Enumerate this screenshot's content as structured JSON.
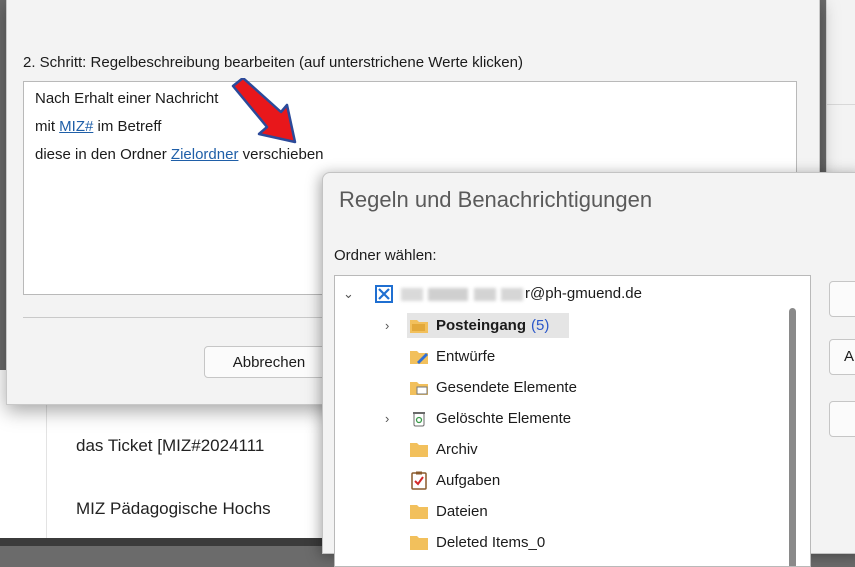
{
  "background": {
    "lines": [
      "das Ticket [MIZ#2024111",
      "MIZ Pädagogische Hochs"
    ]
  },
  "wizard": {
    "step_label": "2. Schritt: Regelbeschreibung bearbeiten (auf unterstrichene Werte klicken)",
    "rule": {
      "line1": "Nach Erhalt einer Nachricht",
      "line2_prefix": "mit ",
      "line2_link": "MIZ#",
      "line2_suffix": " im Betreff",
      "line3_prefix": "diese in den Ordner ",
      "line3_link": "Zielordner",
      "line3_suffix": " verschieben"
    },
    "cancel_label": "Abbrechen"
  },
  "picker": {
    "title": "Regeln und Benachrichtigungen",
    "label": "Ordner wählen:",
    "account": "r@ph-gmuend.de",
    "folders": [
      {
        "label": "Posteingang",
        "count": "(5)",
        "icon": "inbox-icon"
      },
      {
        "label": "Entwürfe",
        "icon": "drafts-icon"
      },
      {
        "label": "Gesendete Elemente",
        "icon": "sent-icon"
      },
      {
        "label": "Gelöschte Elemente",
        "icon": "trash-icon"
      },
      {
        "label": "Archiv",
        "icon": "folder-icon"
      },
      {
        "label": "Aufgaben",
        "icon": "tasks-icon"
      },
      {
        "label": "Dateien",
        "icon": "folder-icon"
      },
      {
        "label": "Deleted Items_0",
        "icon": "folder-icon"
      }
    ],
    "side_button_label": "A"
  },
  "colors": {
    "link": "#1f5fa8",
    "arrow": "#e8171b",
    "folder": "#f2c05c",
    "count": "#2b57c9"
  }
}
